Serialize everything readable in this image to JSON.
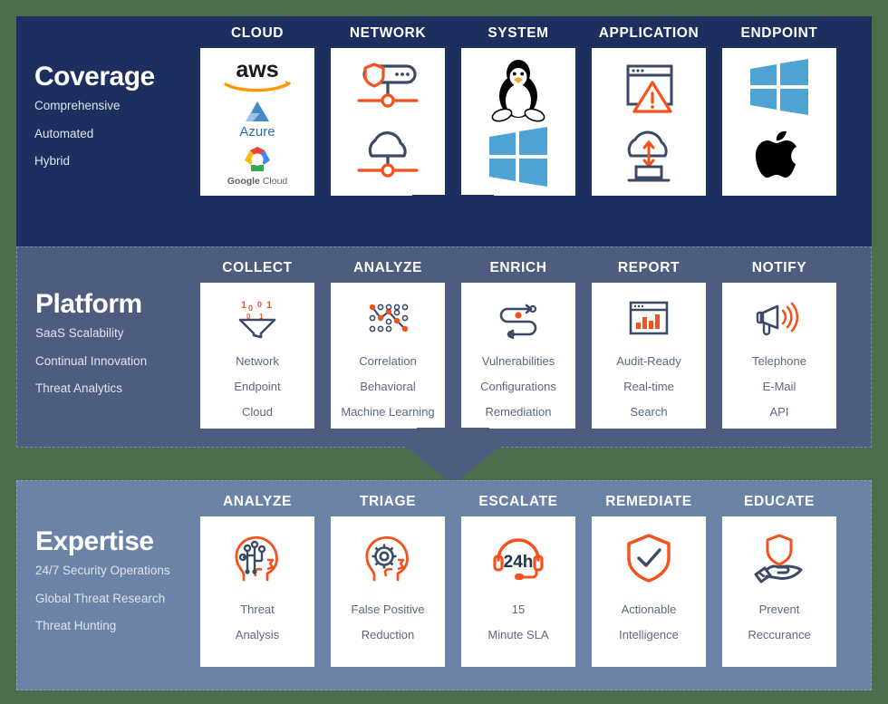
{
  "colors": {
    "background": "#4a6e4e",
    "coverage_band": "#1d2f5e",
    "platform_band": "#4d5c7f",
    "expertise_band": "#6b83a6",
    "card": "#ffffff",
    "accent_orange": "#f4511e",
    "icon_navy": "#3c4a66",
    "card_text": "#5c6781"
  },
  "bands": [
    {
      "id": "coverage",
      "title": "Coverage",
      "subtitles": [
        "Comprehensive",
        "Automated",
        "Hybrid"
      ],
      "columns": [
        {
          "head": "CLOUD",
          "icon": "cloud-providers-icon",
          "lines": []
        },
        {
          "head": "NETWORK",
          "icon": "network-security-icon",
          "lines": []
        },
        {
          "head": "SYSTEM",
          "icon": "operating-systems-icon",
          "lines": []
        },
        {
          "head": "APPLICATION",
          "icon": "application-alert-icon",
          "lines": []
        },
        {
          "head": "ENDPOINT",
          "icon": "endpoint-devices-icon",
          "lines": []
        }
      ]
    },
    {
      "id": "platform",
      "title": "Platform",
      "subtitles": [
        "SaaS Scalability",
        "Continual Innovation",
        "Threat Analytics"
      ],
      "columns": [
        {
          "head": "COLLECT",
          "icon": "funnel-icon",
          "lines": [
            "Network",
            "Endpoint",
            "Cloud"
          ]
        },
        {
          "head": "ANALYZE",
          "icon": "data-nodes-icon",
          "lines": [
            "Correlation",
            "Behavioral",
            "Machine Learning"
          ]
        },
        {
          "head": "ENRICH",
          "icon": "workflow-loop-icon",
          "lines": [
            "Vulnerabilities",
            "Configurations",
            "Remediation"
          ]
        },
        {
          "head": "REPORT",
          "icon": "bar-chart-window-icon",
          "lines": [
            "Audit-Ready",
            "Real-time",
            "Search"
          ]
        },
        {
          "head": "NOTIFY",
          "icon": "megaphone-icon",
          "lines": [
            "Telephone",
            "E-Mail",
            "API"
          ]
        }
      ]
    },
    {
      "id": "expertise",
      "title": "Expertise",
      "subtitles": [
        "24/7 Security Operations",
        "Global Threat Research",
        "Threat Hunting"
      ],
      "columns": [
        {
          "head": "ANALYZE",
          "icon": "head-circuit-icon",
          "lines": [
            "Threat",
            "Analysis"
          ]
        },
        {
          "head": "TRIAGE",
          "icon": "head-gear-icon",
          "lines": [
            "False Positive",
            "Reduction"
          ]
        },
        {
          "head": "ESCALATE",
          "icon": "headset-24h-icon",
          "lines": [
            "15",
            "Minute SLA"
          ]
        },
        {
          "head": "REMEDIATE",
          "icon": "shield-check-icon",
          "lines": [
            "Actionable",
            "Intelligence"
          ]
        },
        {
          "head": "EDUCATE",
          "icon": "hand-shield-icon",
          "lines": [
            "Prevent",
            "Reccurance"
          ]
        }
      ]
    }
  ],
  "coverage_logos": {
    "aws": "aws",
    "azure": "Azure",
    "google_cloud_top": "Google",
    "google_cloud_bottom": "Cloud"
  },
  "escalate_badge": "24h",
  "arrows": [
    {
      "name": "arrow-coverage-to-platform",
      "direction": "down"
    },
    {
      "name": "arrow-platform-to-expertise",
      "direction": "down"
    }
  ]
}
